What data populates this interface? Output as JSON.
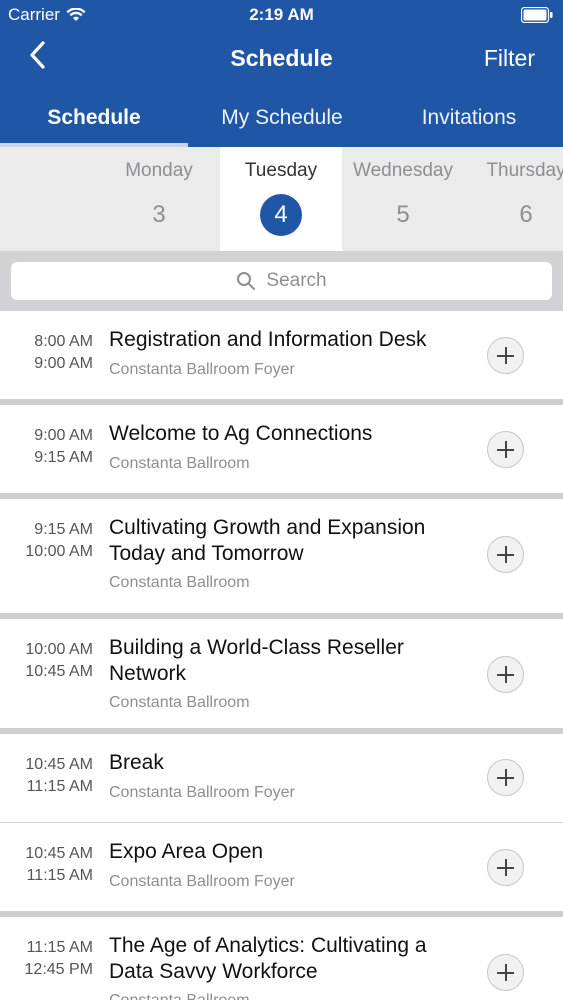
{
  "status_bar": {
    "carrier": "Carrier",
    "time": "2:19 AM"
  },
  "nav": {
    "title": "Schedule",
    "filter_label": "Filter",
    "back_icon": "chevron-left-icon"
  },
  "tabs": [
    {
      "label": "Schedule",
      "active": true
    },
    {
      "label": "My Schedule",
      "active": false
    },
    {
      "label": "Invitations",
      "active": false
    }
  ],
  "days": [
    {
      "name": "Monday",
      "num": "3"
    },
    {
      "name": "Tuesday",
      "num": "4",
      "active": true
    },
    {
      "name": "Wednesday",
      "num": "5"
    },
    {
      "name": "Thursday",
      "num": "6"
    }
  ],
  "search": {
    "placeholder": "Search"
  },
  "sessions": [
    {
      "start": "8:00 AM",
      "end": "9:00 AM",
      "title": "Registration and Information Desk",
      "location": "Constanta Ballroom Foyer"
    },
    {
      "start": "9:00 AM",
      "end": "9:15 AM",
      "title": "Welcome to Ag Connections",
      "location": "Constanta Ballroom"
    },
    {
      "start": "9:15 AM",
      "end": "10:00 AM",
      "title": "Cultivating  Growth and Expansion Today and Tomorrow",
      "location": "Constanta Ballroom"
    },
    {
      "start": "10:00 AM",
      "end": "10:45 AM",
      "title": "Building a World-Class Reseller Network",
      "location": "Constanta Ballroom"
    },
    {
      "start": "10:45 AM",
      "end": "11:15 AM",
      "title": "Break",
      "location": "Constanta Ballroom Foyer"
    },
    {
      "start": "10:45 AM",
      "end": "11:15 AM",
      "title": "Expo Area Open",
      "location": "Constanta Ballroom Foyer"
    },
    {
      "start": "11:15 AM",
      "end": "12:45 PM",
      "title": "The Age of Analytics: Cultivating a Data Savvy Workforce",
      "location": "Constanta Ballroom"
    }
  ],
  "colors": {
    "primary": "#1f57a6",
    "background": "#e6e6e6"
  }
}
